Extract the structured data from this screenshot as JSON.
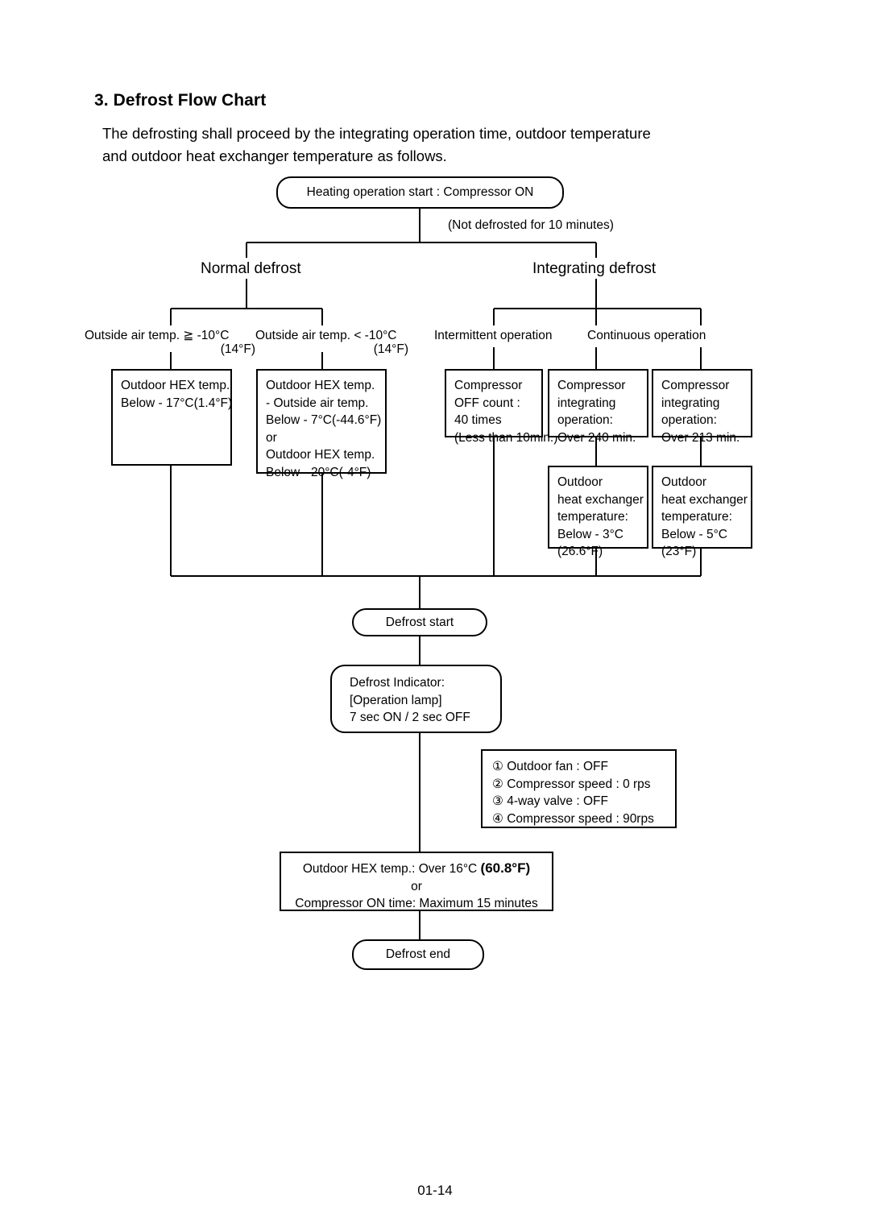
{
  "document": {
    "title": "3. Defrost Flow Chart",
    "intro": "The defrosting shall proceed by the integrating operation time, outdoor temperature and outdoor heat exchanger temperature as follows.",
    "footer": "01-14"
  },
  "chart_data": {
    "type": "diagram",
    "title": "3. Defrost Flow Chart",
    "nodes": {
      "start": "Heating operation start : Compressor ON",
      "start_note": "(Not defrosted for 10 minutes)",
      "branch_normal": "Normal defrost",
      "branch_integrating": "Integrating defrost",
      "cond_outside_ge": "Outside air temp. ≧ -10°C",
      "cond_outside_ge_f": "(14°F)",
      "cond_outside_lt": "Outside air temp. < -10°C",
      "cond_outside_lt_f": "(14°F)",
      "cond_intermittent": "Intermittent operation",
      "cond_continuous": "Continuous operation",
      "box_hex_below17": [
        "Outdoor HEX temp.",
        "Below - 17°C(1.4°F)"
      ],
      "box_hex_diff": [
        "Outdoor HEX temp.",
        "- Outside air temp.",
        "Below - 7°C(-44.6°F)",
        "or",
        "Outdoor HEX temp.",
        "Below - 20°C(-4°F)"
      ],
      "box_off_count": [
        "Compressor",
        "OFF count :",
        "40 times",
        "(Less than 10min.)"
      ],
      "box_integ_240": [
        "Compressor",
        "integrating",
        "operation:",
        "Over 240 min."
      ],
      "box_integ_213": [
        "Compressor",
        "integrating",
        "operation:",
        "Over 213 min."
      ],
      "box_hex_below3": [
        "Outdoor",
        "heat exchanger",
        "temperature:",
        "Below - 3°C",
        "(26.6°F)"
      ],
      "box_hex_below5": [
        "Outdoor",
        "heat exchanger",
        "temperature:",
        "Below - 5°C",
        "(23°F)"
      ],
      "defrost_start": "Defrost start",
      "defrost_indicator": [
        "Defrost Indicator:",
        "[Operation lamp]",
        "7 sec ON / 2 sec OFF"
      ],
      "actions": [
        "① Outdoor fan : OFF",
        "② Compressor speed : 0 rps",
        "③ 4-way valve : OFF",
        "④ Compressor speed : 90rps"
      ],
      "end_condition": {
        "line1_a": "Outdoor HEX temp.: Over 16°C ",
        "line1_b": "(60.8°F)",
        "line2": "or",
        "line3": "Compressor ON time: Maximum 15 minutes"
      },
      "defrost_end": "Defrost end"
    },
    "edges": [
      {
        "from": "start",
        "to": "branch_normal"
      },
      {
        "from": "start",
        "to": "branch_integrating"
      },
      {
        "from": "branch_normal",
        "to": "cond_outside_ge"
      },
      {
        "from": "branch_normal",
        "to": "cond_outside_lt"
      },
      {
        "from": "branch_integrating",
        "to": "cond_intermittent"
      },
      {
        "from": "branch_integrating",
        "to": "cond_continuous"
      },
      {
        "from": "cond_outside_ge",
        "to": "box_hex_below17"
      },
      {
        "from": "cond_outside_lt",
        "to": "box_hex_diff"
      },
      {
        "from": "cond_intermittent",
        "to": "box_off_count"
      },
      {
        "from": "cond_intermittent",
        "to": "box_integ_240"
      },
      {
        "from": "cond_continuous",
        "to": "box_integ_213"
      },
      {
        "from": "box_integ_240",
        "to": "box_hex_below3"
      },
      {
        "from": "box_integ_213",
        "to": "box_hex_below5"
      },
      {
        "from": "box_hex_below17",
        "to": "defrost_start"
      },
      {
        "from": "box_hex_diff",
        "to": "defrost_start"
      },
      {
        "from": "box_off_count",
        "to": "defrost_start"
      },
      {
        "from": "box_hex_below3",
        "to": "defrost_start"
      },
      {
        "from": "box_hex_below5",
        "to": "defrost_start"
      },
      {
        "from": "defrost_start",
        "to": "defrost_indicator"
      },
      {
        "from": "defrost_indicator",
        "to": "end_condition"
      },
      {
        "from": "end_condition",
        "to": "defrost_end"
      }
    ],
    "colors": {
      "line": "#000000",
      "background": "#ffffff",
      "text": "#000000"
    }
  }
}
